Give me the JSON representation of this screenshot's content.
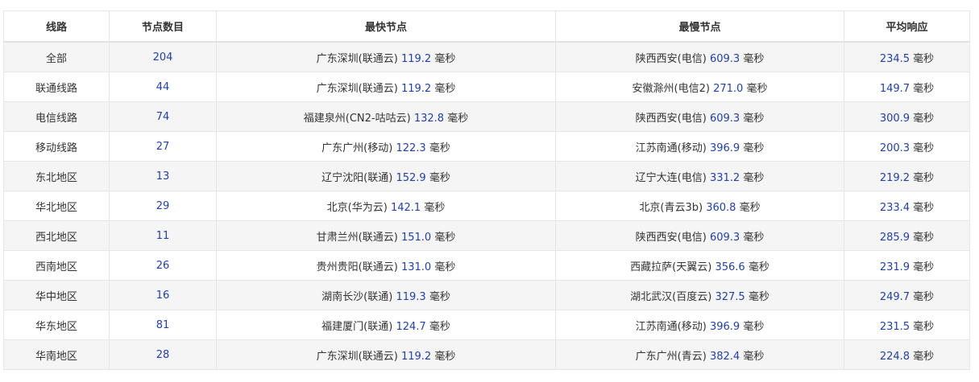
{
  "headers": [
    "线路",
    "节点数目",
    "最快节点",
    "最慢节点",
    "平均响应"
  ],
  "unit": "毫秒",
  "rows": [
    {
      "route": "全部",
      "count": "204",
      "fast_name": "广东深圳(联通云)",
      "fast_ms": "119.2",
      "slow_name": "陕西西安(电信)",
      "slow_ms": "609.3",
      "avg_ms": "234.5"
    },
    {
      "route": "联通线路",
      "count": "44",
      "fast_name": "广东深圳(联通云)",
      "fast_ms": "119.2",
      "slow_name": "安徽滁州(电信2)",
      "slow_ms": "271.0",
      "avg_ms": "149.7"
    },
    {
      "route": "电信线路",
      "count": "74",
      "fast_name": "福建泉州(CN2-咕咕云)",
      "fast_ms": "132.8",
      "slow_name": "陕西西安(电信)",
      "slow_ms": "609.3",
      "avg_ms": "300.9"
    },
    {
      "route": "移动线路",
      "count": "27",
      "fast_name": "广东广州(移动)",
      "fast_ms": "122.3",
      "slow_name": "江苏南通(移动)",
      "slow_ms": "396.9",
      "avg_ms": "200.3"
    },
    {
      "route": "东北地区",
      "count": "13",
      "fast_name": "辽宁沈阳(联通)",
      "fast_ms": "152.9",
      "slow_name": "辽宁大连(电信)",
      "slow_ms": "331.2",
      "avg_ms": "219.2"
    },
    {
      "route": "华北地区",
      "count": "29",
      "fast_name": "北京(华为云)",
      "fast_ms": "142.1",
      "slow_name": "北京(青云3b)",
      "slow_ms": "360.8",
      "avg_ms": "233.4"
    },
    {
      "route": "西北地区",
      "count": "11",
      "fast_name": "甘肃兰州(联通云)",
      "fast_ms": "151.0",
      "slow_name": "陕西西安(电信)",
      "slow_ms": "609.3",
      "avg_ms": "285.9"
    },
    {
      "route": "西南地区",
      "count": "26",
      "fast_name": "贵州贵阳(联通云)",
      "fast_ms": "131.0",
      "slow_name": "西藏拉萨(天翼云)",
      "slow_ms": "356.6",
      "avg_ms": "231.9"
    },
    {
      "route": "华中地区",
      "count": "16",
      "fast_name": "湖南长沙(联通)",
      "fast_ms": "119.3",
      "slow_name": "湖北武汉(百度云)",
      "slow_ms": "327.5",
      "avg_ms": "249.7"
    },
    {
      "route": "华东地区",
      "count": "81",
      "fast_name": "福建厦门(联通)",
      "fast_ms": "124.7",
      "slow_name": "江苏南通(移动)",
      "slow_ms": "396.9",
      "avg_ms": "231.5"
    },
    {
      "route": "华南地区",
      "count": "28",
      "fast_name": "广东深圳(联通云)",
      "fast_ms": "119.2",
      "slow_name": "广东广州(青云)",
      "slow_ms": "382.4",
      "avg_ms": "224.8"
    }
  ],
  "colors": {
    "number": "#1f3fb4",
    "text": "#333333",
    "stripe": "#f5f5f5",
    "border": "#e6e6e6"
  }
}
